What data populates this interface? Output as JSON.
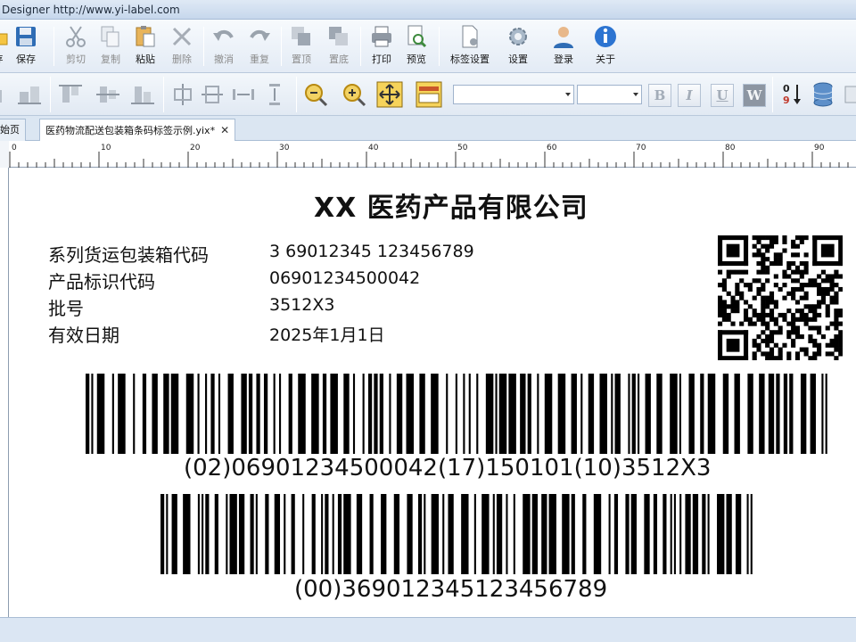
{
  "window": {
    "title": "Designer http://www.yi-label.com"
  },
  "toolbar": {
    "new_label": "",
    "save_label": "保存",
    "cut_label": "剪切",
    "copy_label": "复制",
    "paste_label": "粘贴",
    "delete_label": "删除",
    "undo_label": "撤消",
    "redo_label": "重复",
    "top_label": "置顶",
    "bottom_label": "置底",
    "print_label": "打印",
    "preview_label": "预览",
    "label_settings_label": "标签设置",
    "settings_label": "设置",
    "login_label": "登录",
    "about_label": "关于"
  },
  "format_toolbar": {
    "font_family_value": "",
    "font_size_value": "",
    "bold": "B",
    "italic": "I",
    "underline": "U",
    "wide": "W"
  },
  "tabs": [
    {
      "label": "起始页"
    },
    {
      "label": "医药物流配送包装箱条码标签示例.yix*"
    }
  ],
  "ruler": {
    "labels": [
      "0",
      "10",
      "20",
      "30",
      "40",
      "50",
      "60",
      "70",
      "80",
      "90"
    ]
  },
  "label": {
    "title": "XX 医药产品有限公司",
    "fields": [
      {
        "key": "系列货运包装箱代码",
        "value": "3 69012345 123456789"
      },
      {
        "key": "产品标识代码",
        "value": "06901234500042"
      },
      {
        "key": "批号",
        "value": "3512X3"
      },
      {
        "key": "有效日期",
        "value": "2025年1月1日"
      }
    ],
    "barcode1_text": "(02)06901234500042(17)150101(10)3512X3",
    "barcode2_text": "(00)369012345123456789"
  },
  "colors": {
    "accent": "#2b5ea7",
    "ink": "#111111"
  }
}
